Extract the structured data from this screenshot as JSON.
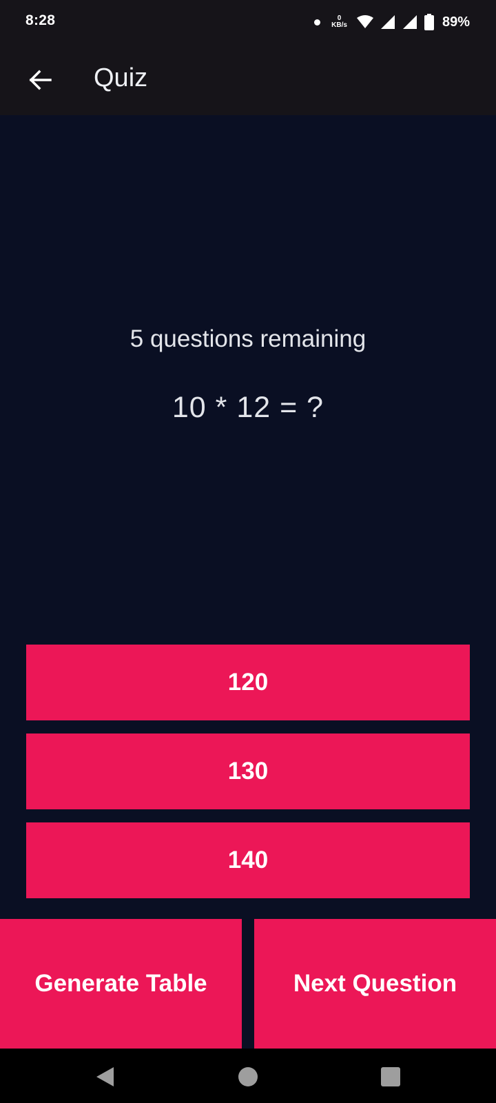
{
  "status_bar": {
    "time": "8:28",
    "net_speed_value": "0",
    "net_speed_unit": "KB/s",
    "battery": "89%"
  },
  "app_bar": {
    "title": "Quiz"
  },
  "quiz": {
    "remaining": "5 questions remaining",
    "question": "10 * 12 = ?",
    "answers": [
      "120",
      "130",
      "140"
    ]
  },
  "actions": {
    "generate_table": "Generate Table",
    "next_question": "Next Question"
  },
  "colors": {
    "background": "#0a0f23",
    "app_bar": "#161419",
    "accent": "#ec1757"
  },
  "icons": {
    "back": "arrow-left-icon",
    "wifi": "wifi-icon",
    "signal": "signal-icon",
    "battery": "battery-icon",
    "nav_back": "triangle-back-icon",
    "nav_home": "circle-home-icon",
    "nav_recents": "square-recents-icon"
  }
}
